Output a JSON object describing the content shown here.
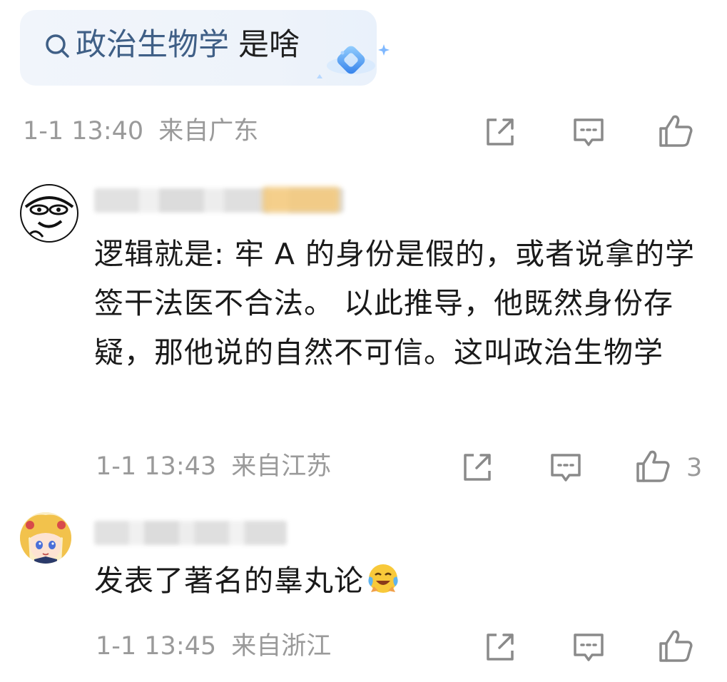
{
  "search": {
    "term": "政治生物学",
    "suffix": "是啥"
  },
  "top_meta": {
    "time": "1-1 13:40",
    "location": "来自广东"
  },
  "comments": [
    {
      "text": "逻辑就是: 牢 A 的身份是假的，或者说拿的学签干法医不合法。 以此推导，他既然身份存疑，那他说的自然不可信。这叫政治生物学",
      "time": "1-1 13:43",
      "location": "来自江苏",
      "likes": "3"
    },
    {
      "text": "发表了著名的辠丸论",
      "time": "1-1 13:45",
      "location": "来自浙江"
    }
  ],
  "icons": {
    "search": "search-icon",
    "share": "share-icon",
    "comment": "comment-icon",
    "like": "thumbs-up-icon",
    "emoji": "crying-laughing-emoji"
  },
  "colors": {
    "search_term": "#3f5f86",
    "meta_gray": "#9a9a9a",
    "text": "#1a1a1a"
  }
}
